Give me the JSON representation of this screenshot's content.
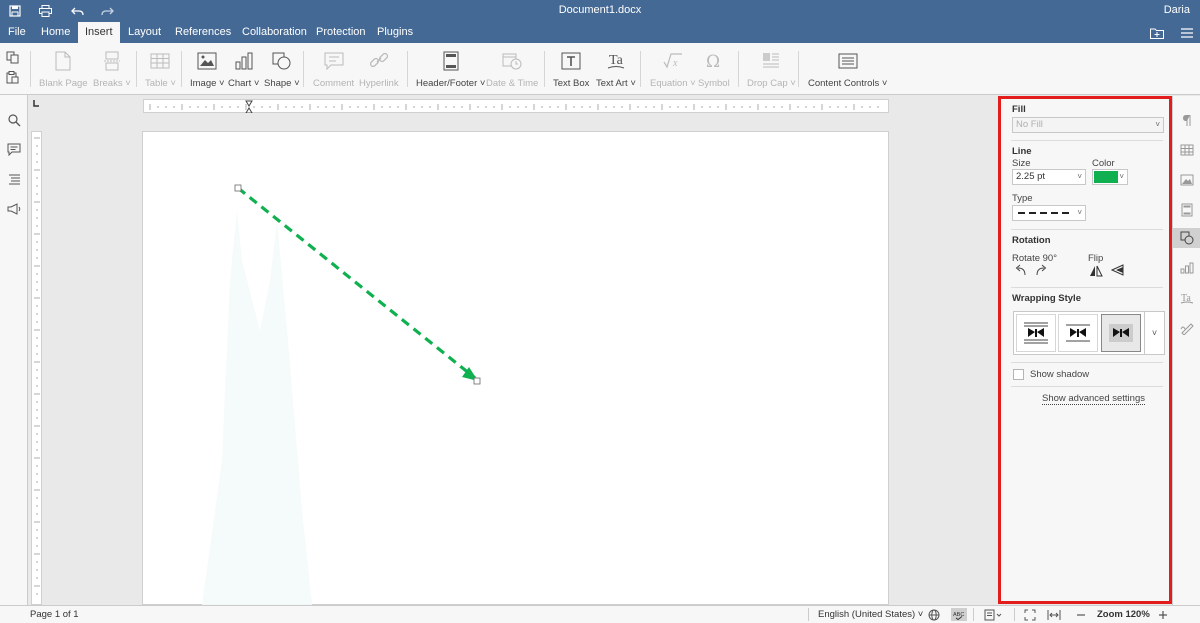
{
  "titlebar": {
    "document_title": "Document1.docx",
    "user_name": "Daria",
    "icons": [
      "save-icon",
      "print-icon",
      "undo-icon",
      "redo-icon"
    ]
  },
  "menu": {
    "tabs": [
      {
        "label": "File"
      },
      {
        "label": "Home"
      },
      {
        "label": "Insert",
        "active": true
      },
      {
        "label": "Layout"
      },
      {
        "label": "References"
      },
      {
        "label": "Collaboration"
      },
      {
        "label": "Protection"
      },
      {
        "label": "Plugins"
      }
    ]
  },
  "toolbar": {
    "blank_page": "Blank Page",
    "breaks": "Breaks",
    "table": "Table",
    "image": "Image",
    "chart": "Chart",
    "shape": "Shape",
    "comment": "Comment",
    "hyperlink": "Hyperlink",
    "header_footer": "Header/Footer",
    "date_time": "Date & Time",
    "text_box": "Text Box",
    "text_art": "Text Art",
    "equation": "Equation",
    "symbol": "Symbol",
    "drop_cap": "Drop Cap",
    "content_controls": "Content Controls"
  },
  "settings": {
    "fill_title": "Fill",
    "fill_value": "No Fill",
    "line_title": "Line",
    "size_label": "Size",
    "size_value": "2.25 pt",
    "color_label": "Color",
    "line_color": "#10b050",
    "type_label": "Type",
    "rotation_title": "Rotation",
    "rotate_label": "Rotate 90°",
    "flip_label": "Flip",
    "wrapping_title": "Wrapping Style",
    "show_shadow": "Show shadow",
    "advanced_link": "Show advanced settings"
  },
  "status": {
    "page_info": "Page 1 of 1",
    "language": "English (United States)",
    "zoom": "Zoom 120%"
  },
  "colors": {
    "header_bg": "#446995",
    "accent_red": "#e31c1c",
    "arrow_color": "#10b050"
  }
}
